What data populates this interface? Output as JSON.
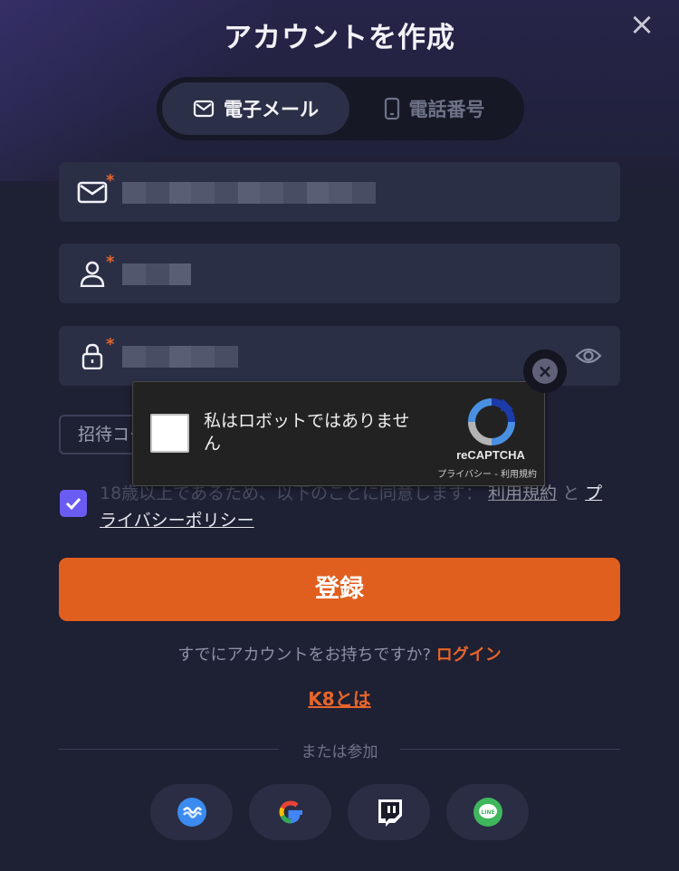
{
  "header": {
    "title": "アカウントを作成"
  },
  "tabs": [
    {
      "label": "電子メール",
      "icon": "mail-icon",
      "active": true
    },
    {
      "label": "電話番号",
      "icon": "phone-icon",
      "active": false
    }
  ],
  "form": {
    "invite_label": "招待コード",
    "consent_text": "18歳以上であるため、以下のことに同意します：",
    "terms_link": "利用規約",
    "and_text": "と",
    "privacy_link_part1": "プ",
    "privacy_link_part2": "ライバシーポリシー",
    "consent_checked": true
  },
  "register_button": "登録",
  "footer": {
    "have_account": "すでにアカウントをお持ちですか?",
    "login": "ログイン",
    "about_k8": "K8とは",
    "or_join": "または参加",
    "social": [
      "wallet-icon",
      "google-icon",
      "twitch-icon",
      "line-icon"
    ]
  },
  "recaptcha": {
    "label": "私はロボットではありません",
    "brand": "reCAPTCHA",
    "links": "プライバシー - 利用規約"
  },
  "colors": {
    "accent": "#e05f1e",
    "checkbox": "#6a5cf2",
    "background": "#1e2033"
  }
}
